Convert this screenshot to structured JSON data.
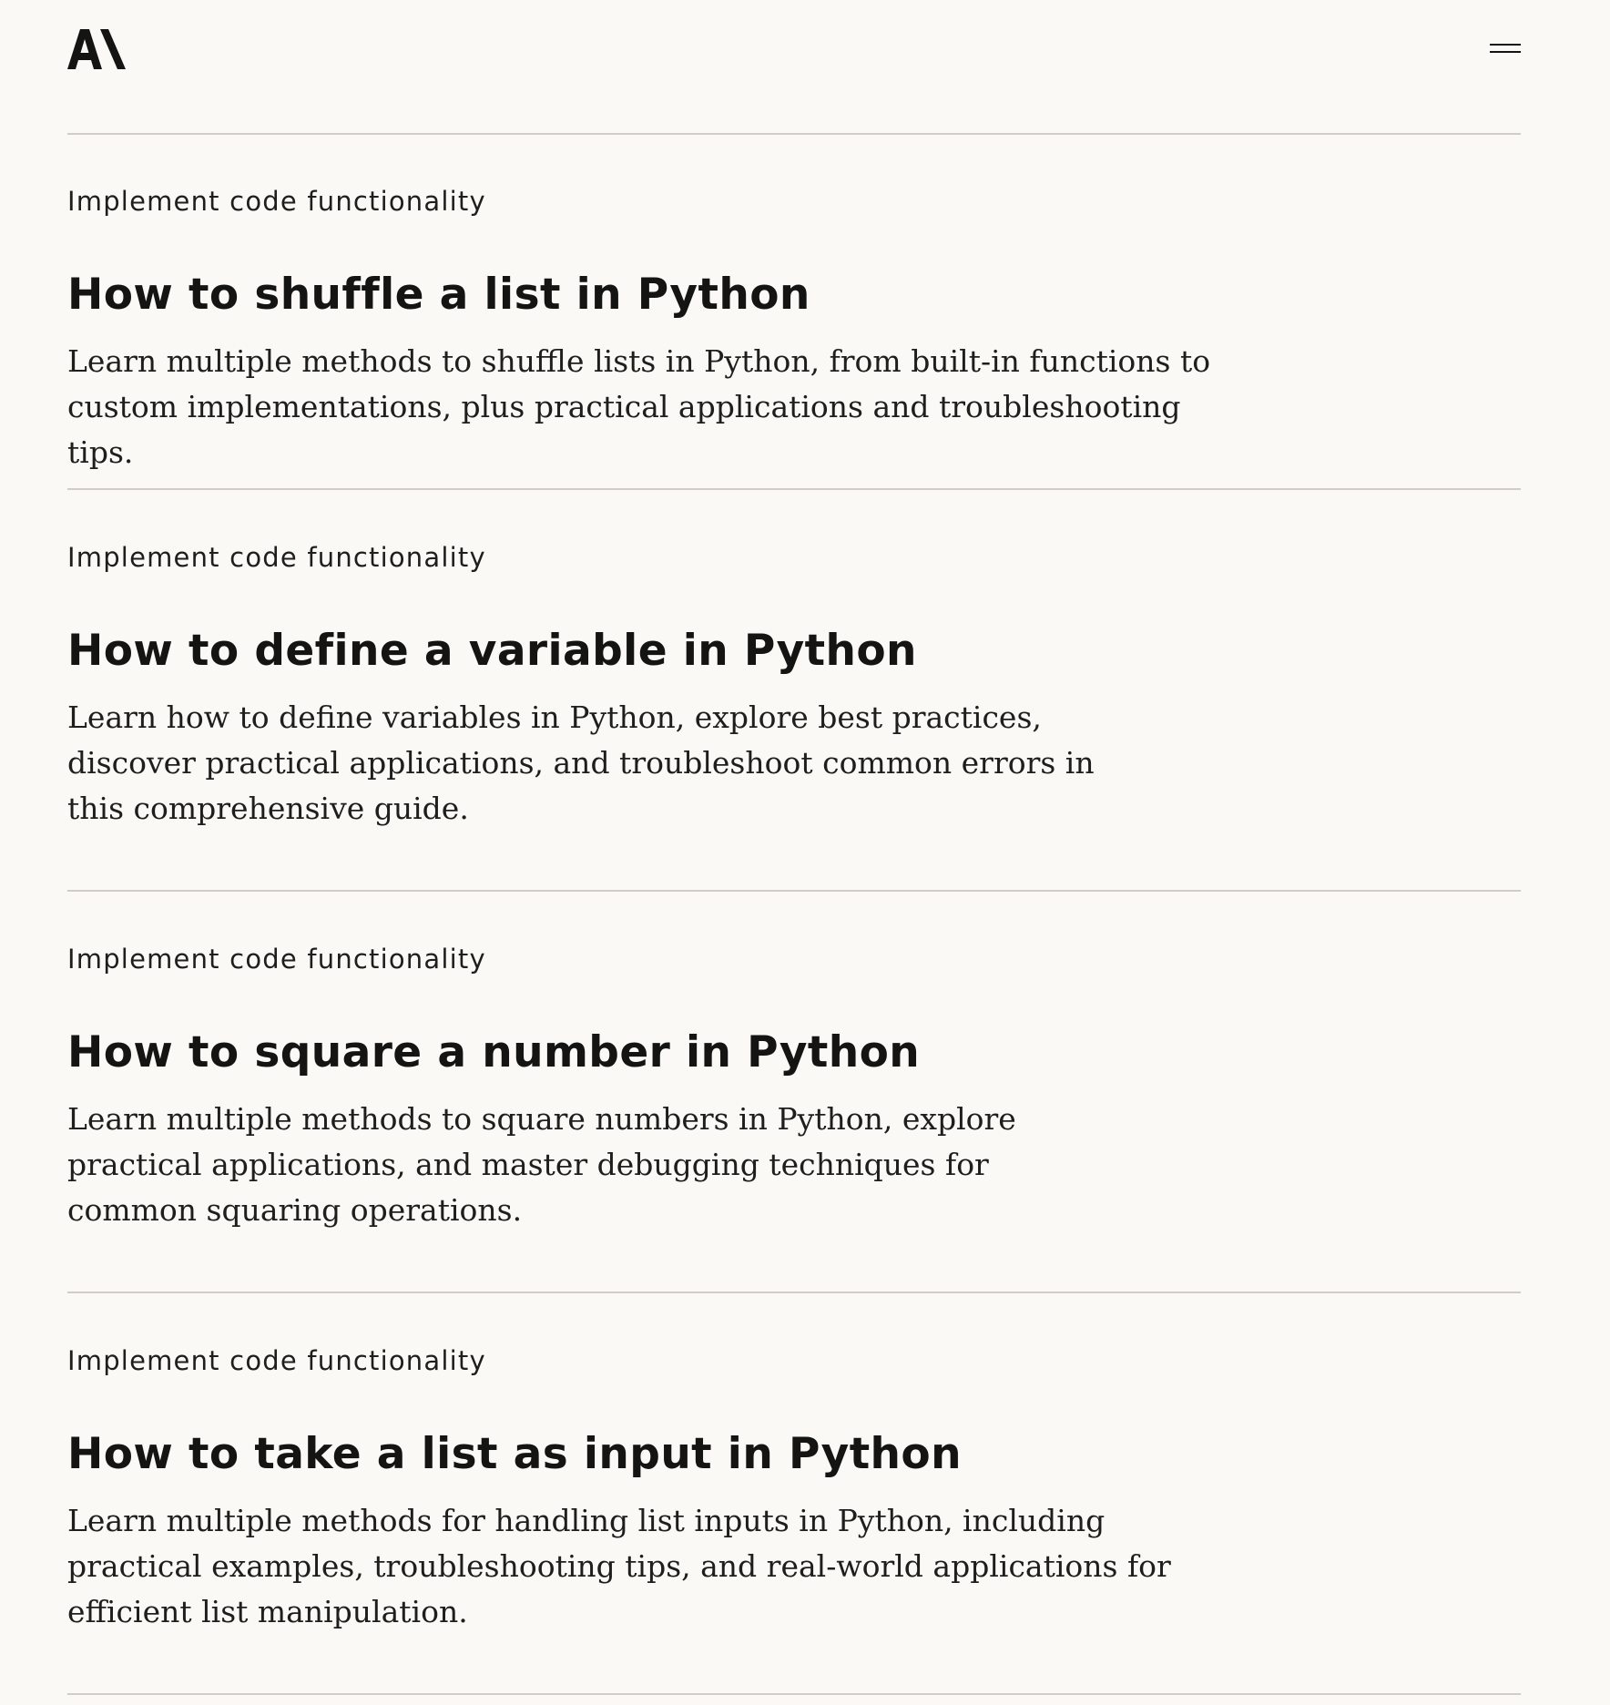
{
  "header": {
    "logo_label": "A\\",
    "menu_icon": "hamburger-menu-icon"
  },
  "articles": [
    {
      "category": "Implement code functionality",
      "title": "How to shuffle a list in Python",
      "description": "Learn multiple methods to shuffle lists in Python, from built-in functions to custom implementations, plus practical applications and troubleshooting tips."
    },
    {
      "category": "Implement code functionality",
      "title": "How to define a variable in Python",
      "description": "Learn how to define variables in Python, explore best practices, discover practical applications, and troubleshoot common errors in this comprehensive guide."
    },
    {
      "category": "Implement code functionality",
      "title": "How to square a number in Python",
      "description": "Learn multiple methods to square numbers in Python, explore practical applications, and master debugging techniques for common squaring operations."
    },
    {
      "category": "Implement code functionality",
      "title": "How to take a list as input in Python",
      "description": "Learn multiple methods for handling list inputs in Python, including practical examples, troubleshooting tips, and real-world applications for efficient list manipulation."
    }
  ],
  "colors": {
    "background": "#faf9f5",
    "text": "#141413",
    "divider": "#cfcdc6"
  }
}
